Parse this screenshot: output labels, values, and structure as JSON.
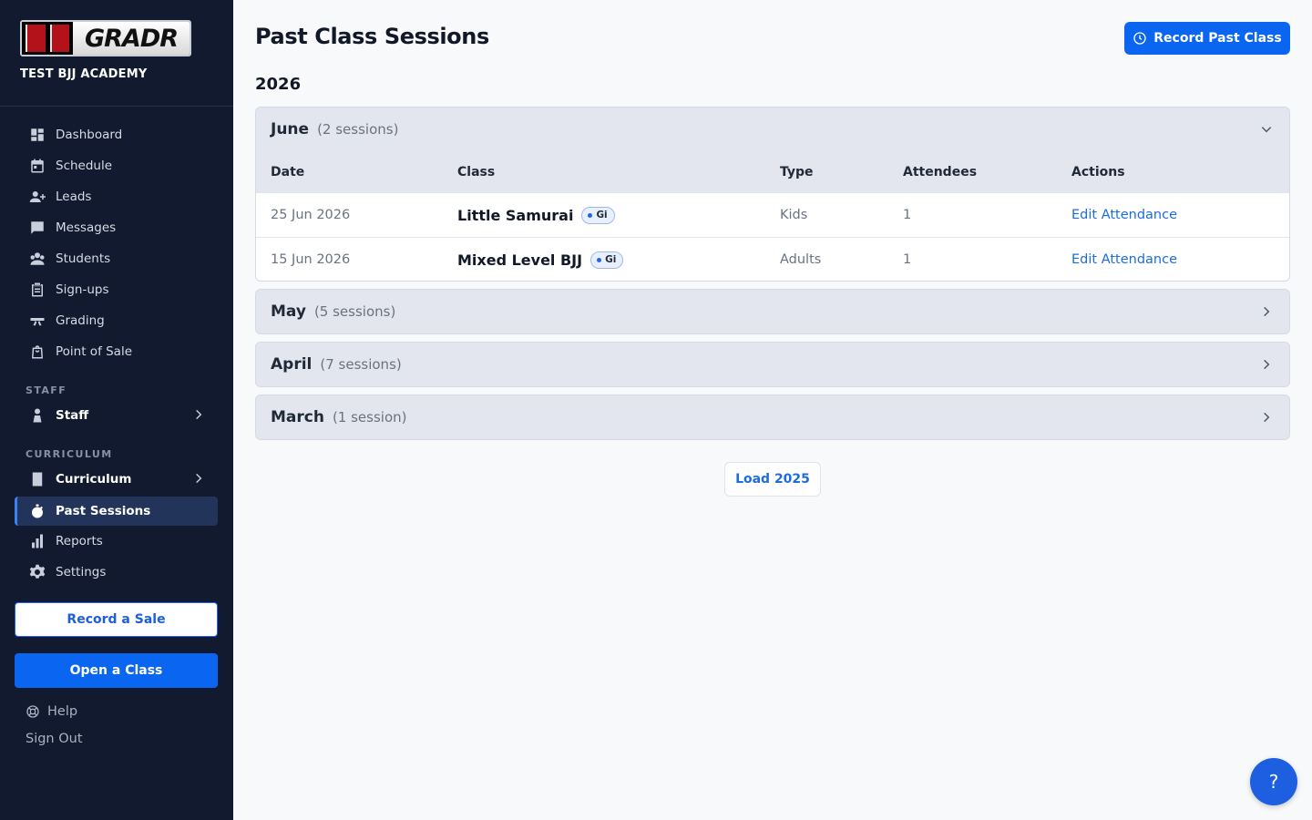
{
  "brand": {
    "logo_text": "GRADR",
    "academy_name": "TEST BJJ ACADEMY"
  },
  "sidebar": {
    "items": [
      {
        "label": "Dashboard",
        "icon": "dashboard-icon"
      },
      {
        "label": "Schedule",
        "icon": "calendar-icon"
      },
      {
        "label": "Leads",
        "icon": "person-add-icon"
      },
      {
        "label": "Messages",
        "icon": "chat-icon"
      },
      {
        "label": "Students",
        "icon": "group-icon"
      },
      {
        "label": "Sign-ups",
        "icon": "clipboard-icon"
      },
      {
        "label": "Grading",
        "icon": "belt-icon"
      },
      {
        "label": "Point of Sale",
        "icon": "bag-icon"
      }
    ],
    "staff_section": "STAFF",
    "staff_item": "Staff",
    "curriculum_section": "CURRICULUM",
    "curriculum_item": "Curriculum",
    "past_sessions": "Past Sessions",
    "reports": "Reports",
    "settings": "Settings",
    "record_sale": "Record a Sale",
    "open_class": "Open a Class",
    "help": "Help",
    "sign_out": "Sign Out"
  },
  "main": {
    "title": "Past Class Sessions",
    "record_button": "Record Past Class",
    "year": "2026",
    "columns": {
      "date": "Date",
      "class": "Class",
      "type": "Type",
      "attendees": "Attendees",
      "actions": "Actions"
    },
    "months": [
      {
        "name": "June",
        "count": "(2 sessions)",
        "expanded": true,
        "rows": [
          {
            "date": "25 Jun 2026",
            "class": "Little Samurai",
            "badge": "Gi",
            "type": "Kids",
            "attendees": "1",
            "action": "Edit Attendance"
          },
          {
            "date": "15 Jun 2026",
            "class": "Mixed Level BJJ",
            "badge": "Gi",
            "type": "Adults",
            "attendees": "1",
            "action": "Edit Attendance"
          }
        ]
      },
      {
        "name": "May",
        "count": "(5 sessions)",
        "expanded": false
      },
      {
        "name": "April",
        "count": "(7 sessions)",
        "expanded": false
      },
      {
        "name": "March",
        "count": "(1 session)",
        "expanded": false
      }
    ],
    "load_button": "Load 2025",
    "help_fab": "?"
  },
  "colors": {
    "sidebar_bg": "#111a2e",
    "accent": "#0a66f0",
    "link": "#1d6ce0",
    "month_bg": "#e3e6ee"
  }
}
